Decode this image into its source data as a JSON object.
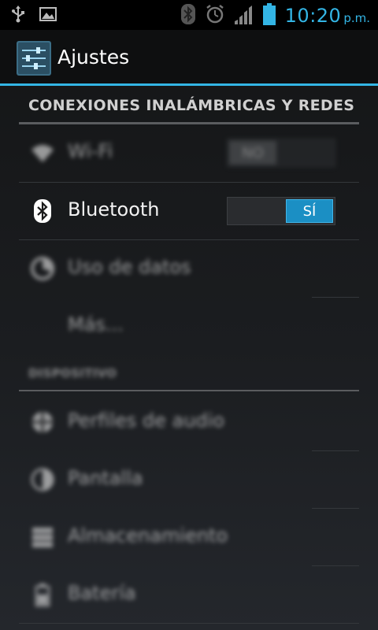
{
  "status_bar": {
    "time": "10:20",
    "ampm": "p.m.",
    "left_icons": [
      "usb-icon",
      "image-icon"
    ],
    "right_icons": [
      "bluetooth-icon",
      "alarm-icon",
      "signal-icon",
      "battery-icon"
    ],
    "accent_color": "#33b5e5"
  },
  "action_bar": {
    "title": "Ajustes",
    "icon": "settings-sliders-icon"
  },
  "sections": [
    {
      "header": "CONEXIONES INALÁMBRICAS Y REDES",
      "items": [
        {
          "label": "Wi-Fi",
          "icon": "wifi-icon",
          "toggle": "NO"
        },
        {
          "label": "Bluetooth",
          "icon": "bluetooth-icon",
          "toggle": "SÍ"
        },
        {
          "label": "Uso de datos",
          "icon": "data-usage-icon"
        },
        {
          "label": "Más..."
        }
      ]
    },
    {
      "header": "DISPOSITIVO",
      "items": [
        {
          "label": "Perfiles de audio",
          "icon": "audio-profiles-icon"
        },
        {
          "label": "Pantalla",
          "icon": "display-icon"
        },
        {
          "label": "Almacenamiento",
          "icon": "storage-icon"
        },
        {
          "label": "Batería",
          "icon": "battery-settings-icon"
        }
      ]
    }
  ]
}
